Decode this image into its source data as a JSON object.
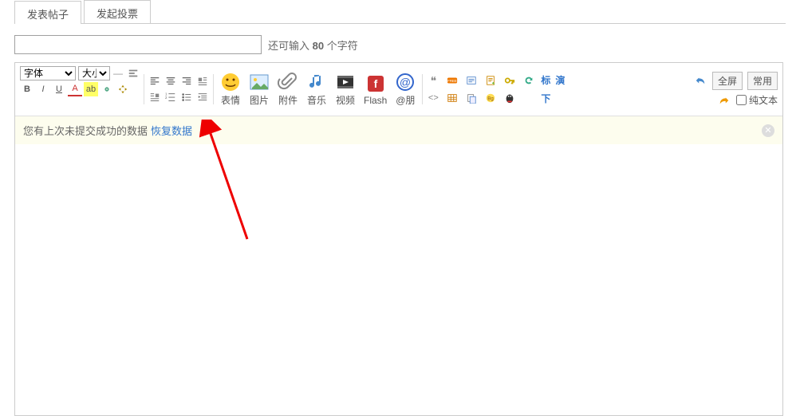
{
  "tabs": {
    "post": "发表帖子",
    "poll": "发起投票"
  },
  "title_input": {
    "value": "",
    "placeholder": ""
  },
  "hint": {
    "prefix": "还可输入 ",
    "count": "80",
    "suffix": " 个字符"
  },
  "font_select": "字体",
  "size_select": "大小",
  "big": {
    "emoji": "表情",
    "image": "图片",
    "attach": "附件",
    "music": "音乐",
    "video": "视频",
    "flash": "Flash",
    "friend": "@朋"
  },
  "labels": {
    "biao": "标",
    "yan": "演",
    "xia": "下"
  },
  "right": {
    "full": "全屏",
    "common": "常用",
    "plain": "纯文本"
  },
  "notice": {
    "text": "您有上次未提交成功的数据",
    "link": "恢复数据"
  }
}
